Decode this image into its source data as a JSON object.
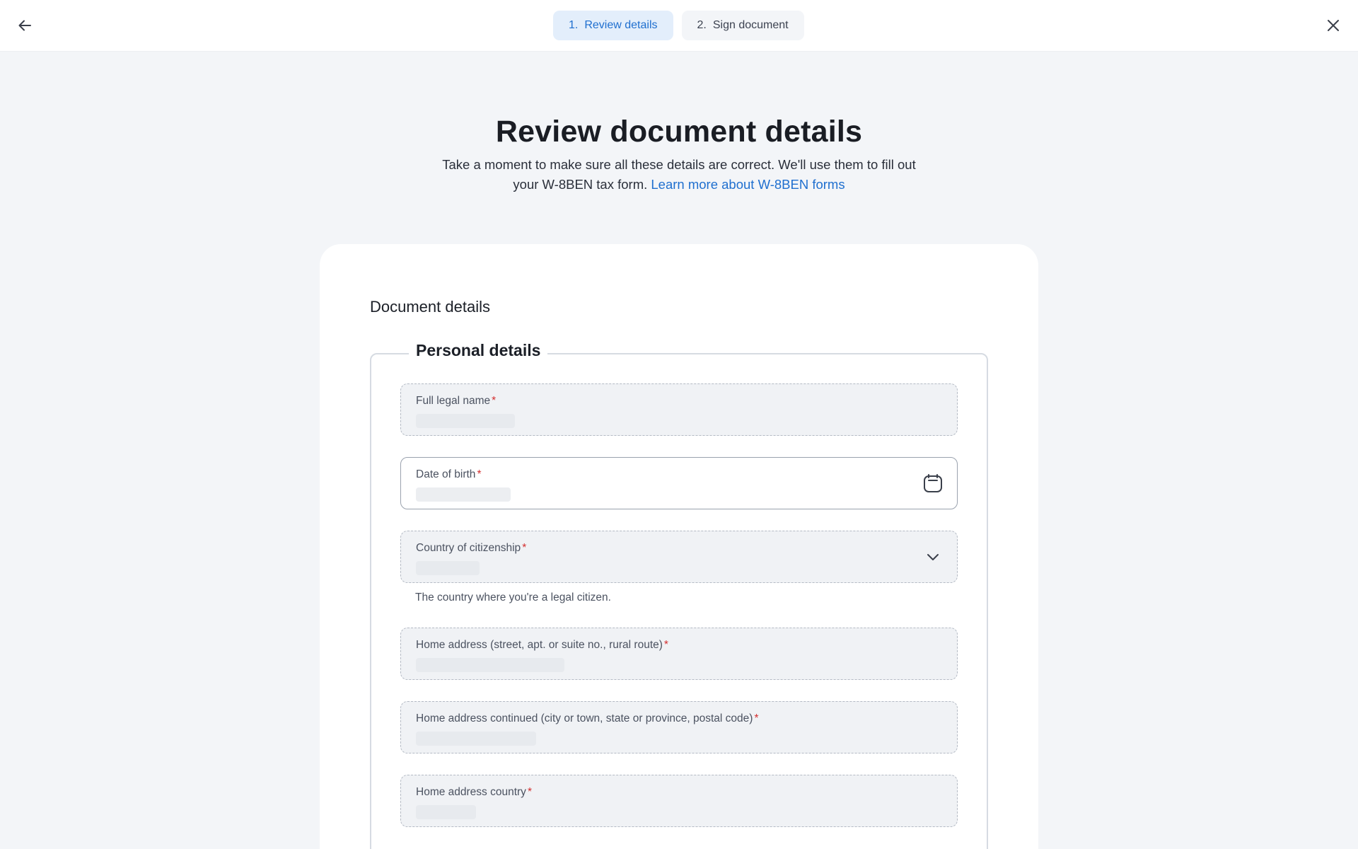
{
  "steps": [
    {
      "number": "1.",
      "label": "Review details"
    },
    {
      "number": "2.",
      "label": "Sign document"
    }
  ],
  "header": {
    "title": "Review document details",
    "intro_text": "Take a moment to make sure all these details are correct. We'll use them to fill out your W-8BEN tax form.",
    "learn_more_link": "Learn more about W-8BEN forms"
  },
  "card": {
    "title": "Document details",
    "section_title": "Personal details",
    "fields": [
      {
        "label": "Full legal name",
        "required": "*"
      },
      {
        "label": "Date of birth",
        "required": "*"
      },
      {
        "label": "Country of citizenship",
        "required": "*",
        "helper": "The country where you're a legal citizen."
      },
      {
        "label": "Home address (street, apt. or suite no., rural route)",
        "required": "*"
      },
      {
        "label": "Home address continued (city or town, state or province, postal code)",
        "required": "*"
      },
      {
        "label": "Home address country",
        "required": "*"
      }
    ]
  },
  "icons": {
    "back": "arrow-left-icon",
    "close": "close-icon",
    "calendar": "calendar-icon",
    "dropdown": "chevron-down-icon"
  },
  "colors": {
    "accent": "#1f6fcf",
    "active_step_bg": "#e3eefb",
    "required": "#d32f2f",
    "page_bg": "#f3f5f8"
  }
}
